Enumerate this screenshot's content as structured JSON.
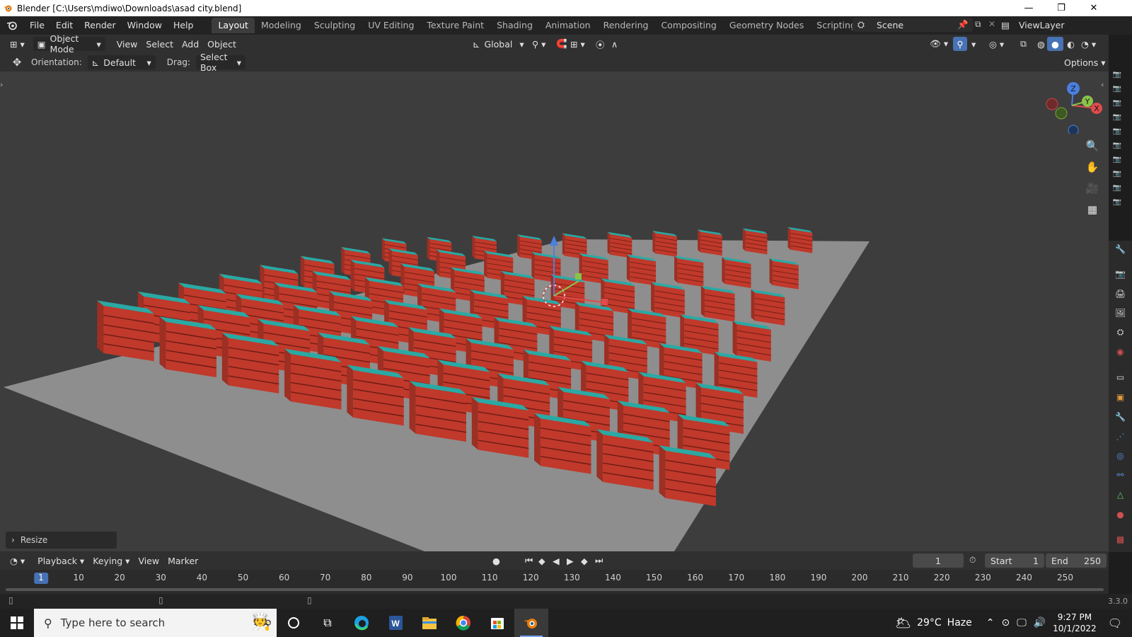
{
  "window": {
    "title": "Blender [C:\\Users\\mdiwo\\Downloads\\asad city.blend]",
    "controls": {
      "minimize": "—",
      "maximize": "❐",
      "close": "✕"
    }
  },
  "menu": [
    "File",
    "Edit",
    "Render",
    "Window",
    "Help"
  ],
  "workspaces": [
    "Layout",
    "Modeling",
    "Sculpting",
    "UV Editing",
    "Texture Paint",
    "Shading",
    "Animation",
    "Rendering",
    "Compositing",
    "Geometry Nodes",
    "Scripting"
  ],
  "active_workspace": "Layout",
  "add_workspace": "+",
  "scene": {
    "name": "Scene",
    "view_layer": "ViewLayer"
  },
  "viewport_header": {
    "mode": "Object Mode",
    "menus": [
      "View",
      "Select",
      "Add",
      "Object"
    ],
    "transform_orientation": "Global",
    "options": "Options"
  },
  "tool_header": {
    "orientation_label": "Orientation:",
    "orientation_value": "Default",
    "drag_label": "Drag:",
    "drag_value": "Select Box"
  },
  "gizmo": {
    "x": "X",
    "y": "Y",
    "z": "Z"
  },
  "last_operation": "Resize",
  "timeline": {
    "menus": [
      "Playback",
      "Keying",
      "View",
      "Marker"
    ],
    "current_frame": "1",
    "start_label": "Start",
    "start": "1",
    "end_label": "End",
    "end": "250",
    "ruler_current": "1",
    "ruler_ticks": [
      "10",
      "20",
      "30",
      "40",
      "50",
      "60",
      "70",
      "80",
      "90",
      "100",
      "110",
      "120",
      "130",
      "140",
      "150",
      "160",
      "170",
      "180",
      "190",
      "200",
      "210",
      "220",
      "230",
      "240",
      "250"
    ]
  },
  "version": "3.3.0",
  "taskbar": {
    "search_placeholder": "Type here to search",
    "weather_temp": "29°C",
    "weather_text": "Haze",
    "time": "9:27 PM",
    "date": "10/1/2022"
  },
  "colors": {
    "building_body": "#c0392b",
    "building_roof": "#2aa9a4",
    "ground": "#8e8e8e",
    "viewport_bg": "#3d3d3d",
    "active_tab": "#3d3d3d",
    "accent": "#4772b3"
  }
}
